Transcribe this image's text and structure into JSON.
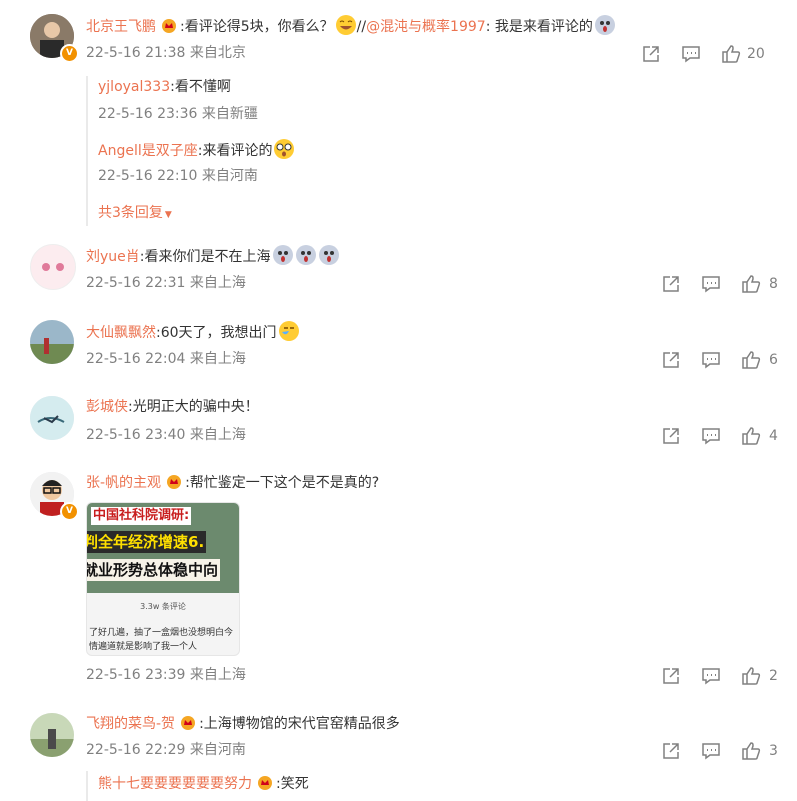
{
  "comments": [
    {
      "user": "北京王飞鹏",
      "text": ":看评论得5块，你看么？",
      "forward_sep": "//",
      "forward_user": "@混沌与概率1997",
      "forward_text": ": 我是来看评论的",
      "meta": "22-5-16 21:38 来自北京",
      "likes": "20",
      "replies": [
        {
          "user": "yjloyal333",
          "text": ":看不懂啊",
          "meta": "22-5-16 23:36 来自新疆"
        },
        {
          "user": "Angell是双子座",
          "text": ":来看评论的",
          "meta": "22-5-16 22:10 来自河南"
        }
      ],
      "more_label": "共3条回复"
    },
    {
      "user": "刘yue肖",
      "text": ":看来你们是不在上海",
      "meta": "22-5-16 22:31 来自上海",
      "likes": "8"
    },
    {
      "user": "大仙飘飘然",
      "text": ":60天了，我想出门",
      "meta": "22-5-16 22:04 来自上海",
      "likes": "6"
    },
    {
      "user": "彭城侠",
      "text": ":光明正大的骗中央！",
      "meta": "22-5-16 23:40 来自上海",
      "likes": "4"
    },
    {
      "user": "张-帆的主观",
      "text": ":帮忙鉴定一下这个是不是真的?",
      "meta": "22-5-16 23:39 来自上海",
      "likes": "2",
      "image": {
        "headline1": "中国社科院调研:",
        "headline2": "判全年经济增速6.",
        "headline3": "就业形势总体稳中向",
        "count": "3.3w 条评论",
        "caption1": "了好几遍，抽了一盒烟也没想明白今",
        "caption2": "情遍道就是影响了我一个人"
      }
    },
    {
      "user": "飞翔的菜鸟-贺",
      "text": ":上海博物馆的宋代官窑精品很多",
      "meta": "22-5-16 22:29 来自河南",
      "likes": "3",
      "replies": [
        {
          "user": "熊十七要要要要要要努力",
          "text": ":笑死"
        }
      ]
    }
  ],
  "colors": {
    "username": "#eb7350",
    "text": "#333333",
    "meta": "#808080",
    "badge": "#f29100"
  },
  "icons": [
    "share-icon",
    "comment-icon",
    "like-icon",
    "crown-badge-icon",
    "verified-badge-icon"
  ]
}
